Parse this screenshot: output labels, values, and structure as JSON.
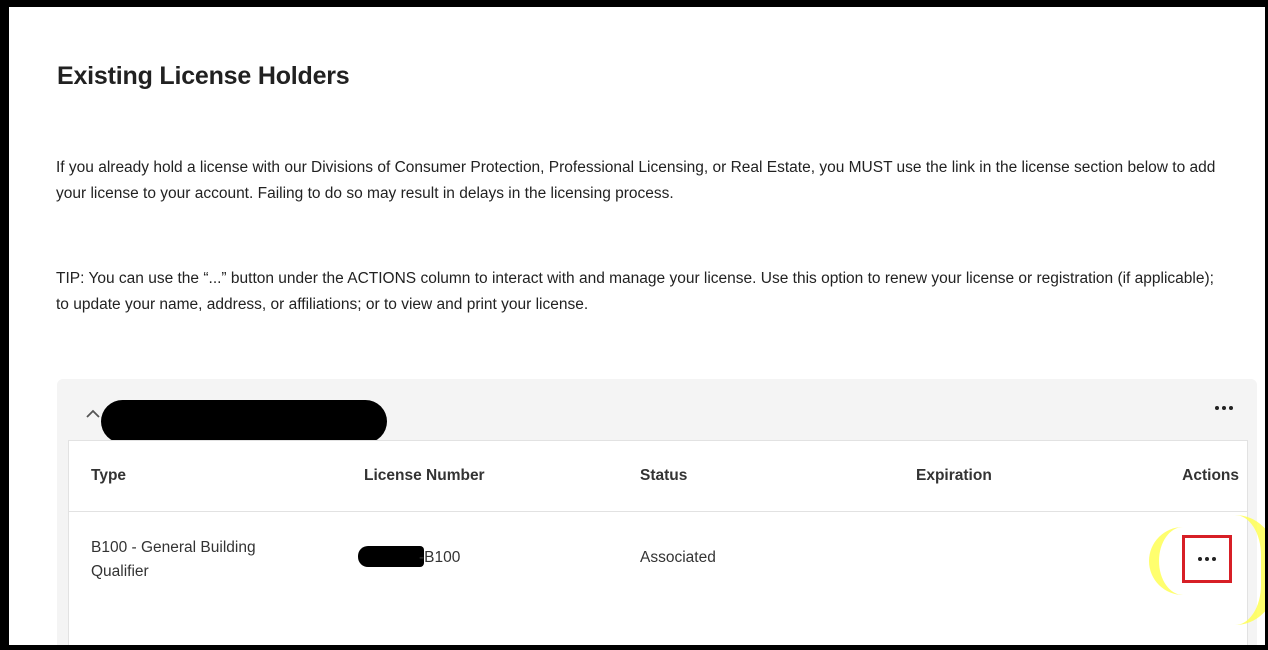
{
  "page": {
    "title": "Existing License Holders",
    "intro": "If you already hold a license with our Divisions of Consumer Protection, Professional Licensing, or Real Estate, you MUST use the link in the license section below to add your license to your account. Failing to do so may result in delays in the licensing process.",
    "tip": "TIP: You can use the “...” button under the ACTIONS column to interact with and manage your license. Use this option to renew your license or registration (if applicable); to update your name, address, or affiliations; or to view and print your license."
  },
  "license_card": {
    "owner_name": "",
    "collapse_icon": "chevron-up-icon",
    "more_icon": "more-horizontal-icon",
    "columns": [
      "Type",
      "License Number",
      "Status",
      "Expiration",
      "Actions"
    ],
    "rows": [
      {
        "type": "B100 - General Building Qualifier",
        "license_number": "-B100",
        "status": "Associated",
        "expiration": "",
        "actions_icon": "more-horizontal-icon"
      }
    ]
  },
  "annotations": {
    "highlight_color": "#ffff55",
    "box_color": "#d71f26"
  }
}
